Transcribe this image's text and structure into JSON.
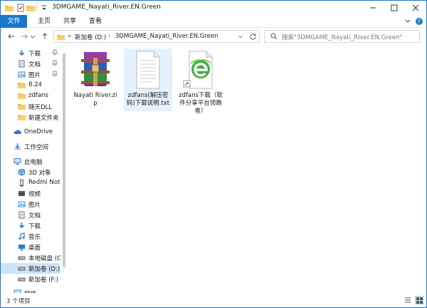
{
  "window": {
    "title": "3DMGAME_Nayati_River.EN.Green",
    "accent": "#1979ca"
  },
  "ribbon": {
    "tabs": [
      {
        "label": "文件"
      },
      {
        "label": "主页"
      },
      {
        "label": "共享"
      },
      {
        "label": "查看"
      }
    ]
  },
  "address": {
    "prefix": "«",
    "crumbs": [
      "新加卷 (D:)",
      "3DMGAME_Nayati_River.EN.Green"
    ]
  },
  "search": {
    "placeholder": "搜索\"3DMGAME_Nayati_River.EN.Green\""
  },
  "sidebar": {
    "quick_access": [
      {
        "label": "下载",
        "icon": "download-icon",
        "pinned": true
      },
      {
        "label": "文档",
        "icon": "document-icon",
        "pinned": true
      },
      {
        "label": "图片",
        "icon": "picture-icon",
        "pinned": true
      },
      {
        "label": "8.24",
        "icon": "folder-icon",
        "pinned": false
      },
      {
        "label": "zdfans",
        "icon": "folder-icon",
        "pinned": false
      },
      {
        "label": "随天DLL",
        "icon": "folder-icon",
        "pinned": false
      },
      {
        "label": "新建文件夹",
        "icon": "folder-icon",
        "pinned": false
      }
    ],
    "onedrive": "OneDrive",
    "workspace": "工作空间",
    "this_pc": "此电脑",
    "pc_items": [
      {
        "label": "3D 对象",
        "icon": "3d-objects-icon"
      },
      {
        "label": "Redmi Note",
        "icon": "phone-icon"
      },
      {
        "label": "视频",
        "icon": "video-icon"
      },
      {
        "label": "图片",
        "icon": "picture-icon"
      },
      {
        "label": "文档",
        "icon": "document-icon"
      },
      {
        "label": "下载",
        "icon": "download-icon"
      },
      {
        "label": "音乐",
        "icon": "music-icon"
      },
      {
        "label": "桌面",
        "icon": "desktop-icon"
      },
      {
        "label": "本地磁盘 (C",
        "icon": "drive-icon"
      },
      {
        "label": "新加卷 (D:)",
        "icon": "drive-icon",
        "selected": true
      },
      {
        "label": "新加卷 (F:)",
        "icon": "drive-icon"
      },
      {
        "label": "网络",
        "icon": "network-icon"
      }
    ]
  },
  "files": [
    {
      "name": "Nayati River.zip",
      "icon": "winrar-archive-icon",
      "selected": false
    },
    {
      "name": "zdfans(解压密码)下载说明.txt",
      "icon": "text-file-icon",
      "selected": true
    },
    {
      "name": "zdfans下载（软件分享平台领跑者）",
      "icon": "internet-shortcut-icon",
      "selected": false
    }
  ],
  "status": {
    "count_text": "3 个项目"
  }
}
